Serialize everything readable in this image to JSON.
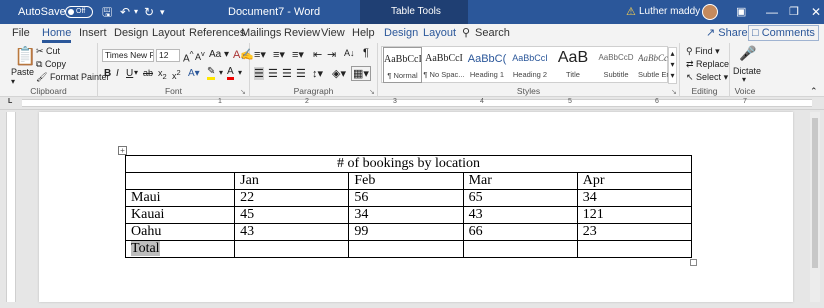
{
  "titlebar": {
    "autosave": "AutoSave",
    "autosave_state": "Off",
    "undo_icon": "undo-icon",
    "redo_icon": "redo-icon",
    "doc_title": "Document7 - Word",
    "context_tab": "Table Tools",
    "user": "Luther maddy"
  },
  "menu": {
    "tabs": [
      "File",
      "Home",
      "Insert",
      "Design",
      "Layout",
      "References",
      "Mailings",
      "Review",
      "View",
      "Help"
    ],
    "context_tabs": [
      "Design",
      "Layout"
    ],
    "search": "Search",
    "share": "Share",
    "comments": "Comments"
  },
  "ribbon": {
    "clipboard": {
      "paste": "Paste",
      "cut": "Cut",
      "copy": "Copy",
      "format_painter": "Format Painter",
      "label": "Clipboard"
    },
    "font": {
      "name": "Times New Ro",
      "size": "12",
      "grow": "A",
      "shrink": "A",
      "case": "Aa",
      "label": "Font"
    },
    "paragraph": {
      "label": "Paragraph"
    },
    "styles": {
      "items": [
        {
          "preview": "AaBbCcI",
          "name": "¶ Normal"
        },
        {
          "preview": "AaBbCcI",
          "name": "¶ No Spac..."
        },
        {
          "preview": "AaBbC(",
          "name": "Heading 1"
        },
        {
          "preview": "AaBbCcI",
          "name": "Heading 2"
        },
        {
          "preview": "AaB",
          "name": "Title"
        },
        {
          "preview": "AaBbCcD",
          "name": "Subtitle"
        },
        {
          "preview": "AaBbCcL",
          "name": "Subtle Em..."
        }
      ],
      "label": "Styles"
    },
    "editing": {
      "find": "Find",
      "replace": "Replace",
      "select": "Select",
      "label": "Editing"
    },
    "voice": {
      "dictate": "Dictate",
      "label": "Voice"
    }
  },
  "ruler": {
    "numbers": [
      "1",
      "2",
      "3",
      "4",
      "5",
      "6",
      "7"
    ]
  },
  "table": {
    "title": "# of bookings by location",
    "header": [
      "",
      "Jan",
      "Feb",
      "Mar",
      "Apr"
    ],
    "rows": [
      [
        "Maui",
        "22",
        "56",
        "65",
        "34"
      ],
      [
        "Kauai",
        "45",
        "34",
        "43",
        "121"
      ],
      [
        "Oahu",
        "43",
        "99",
        "66",
        "23"
      ],
      [
        "Total",
        "",
        "",
        "",
        ""
      ]
    ]
  },
  "colors": {
    "accent": "#2b579a",
    "titlebar": "#2b579a",
    "context": "#1f3f73"
  }
}
